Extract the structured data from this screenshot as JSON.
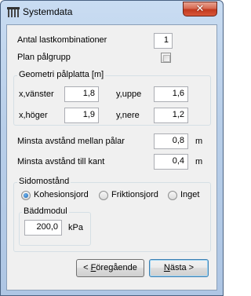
{
  "window": {
    "title": "Systemdata",
    "close_label": "✕"
  },
  "fields": {
    "antal_label": "Antal lastkombinationer",
    "antal_value": "1",
    "plan_label": "Plan pålgrupp"
  },
  "geometri": {
    "title": "Geometri pålplatta [m]",
    "x_vanster_label": "x,vänster",
    "x_vanster_value": "1,8",
    "y_uppe_label": "y,uppe",
    "y_uppe_value": "1,6",
    "x_hoger_label": "x,höger",
    "x_hoger_value": "1,9",
    "y_nere_label": "y,nere",
    "y_nere_value": "1,2"
  },
  "avstand": {
    "palar_label": "Minsta avstånd mellan pålar",
    "palar_value": "0,8",
    "palar_unit": "m",
    "kant_label": "Minsta avstånd till kant",
    "kant_value": "0,4",
    "kant_unit": "m"
  },
  "sidomostand": {
    "title": "Sidomostånd",
    "options": [
      "Kohesionsjord",
      "Friktionsjord",
      "Inget"
    ],
    "selected": "Kohesionsjord",
    "baddmodul_title": "Bäddmodul",
    "baddmodul_value": "200,0",
    "baddmodul_unit": "kPa"
  },
  "buttons": {
    "prev_prefix": "< ",
    "prev_mnemonic": "F",
    "prev_rest": "öregående",
    "next_mnemonic": "N",
    "next_rest": "ästa >"
  },
  "icons": {
    "app": "pile-group-icon",
    "close": "close-icon"
  }
}
